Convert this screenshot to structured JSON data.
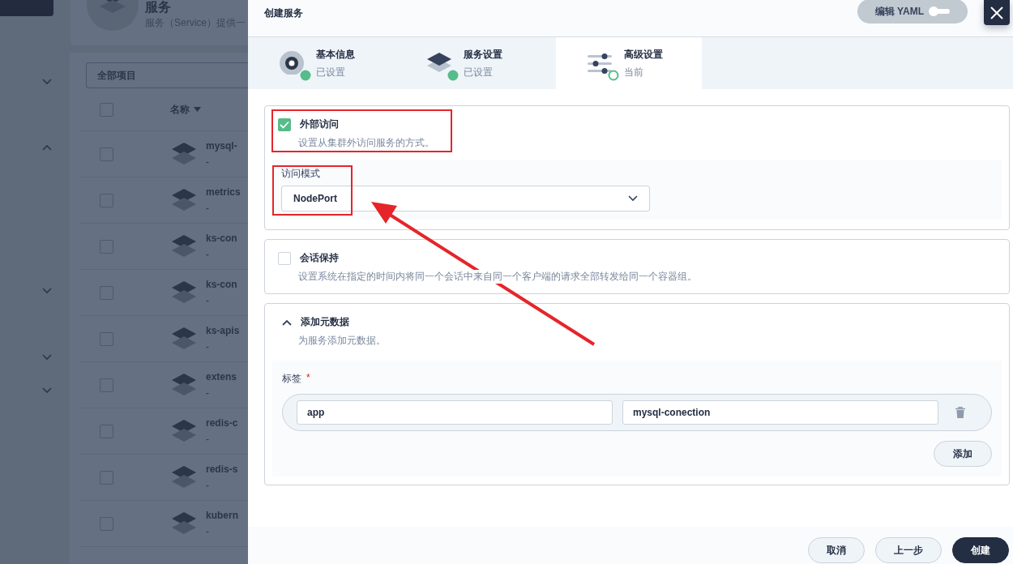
{
  "background_page": {
    "title": "服务",
    "subtitle": "服务（Service）提供一",
    "filter": "全部项目",
    "name_column": "名称",
    "header_checked": false,
    "sidebar_toggles": [
      {
        "expanded": false
      },
      {
        "expanded": true
      },
      {
        "expanded": false
      },
      {
        "expanded": false
      },
      {
        "expanded": false
      }
    ],
    "rows": [
      {
        "name": "mysql-",
        "detail": "-",
        "checked": false
      },
      {
        "name": "metrics",
        "detail": "-",
        "checked": false
      },
      {
        "name": "ks-con",
        "detail": "-",
        "checked": false
      },
      {
        "name": "ks-con",
        "detail": "-",
        "checked": false
      },
      {
        "name": "ks-apis",
        "detail": "-",
        "checked": false
      },
      {
        "name": "extens",
        "detail": "-",
        "checked": false
      },
      {
        "name": "redis-c",
        "detail": "-",
        "checked": false
      },
      {
        "name": "redis-s",
        "detail": "-",
        "checked": false
      },
      {
        "name": "kubern",
        "detail": "-",
        "checked": false
      }
    ]
  },
  "dialog": {
    "title": "创建服务",
    "yaml_toggle": {
      "label": "编辑 YAML",
      "on": false
    },
    "steps": [
      {
        "kind": "basic",
        "title": "基本信息",
        "status": "已设置",
        "completed": true,
        "selected": false
      },
      {
        "kind": "service",
        "title": "服务设置",
        "status": "已设置",
        "completed": true,
        "selected": false
      },
      {
        "kind": "advanced",
        "title": "高级设置",
        "status": "当前",
        "completed": false,
        "selected": true
      }
    ],
    "external_access": {
      "label": "外部访问",
      "description": "设置从集群外访问服务的方式。",
      "checked": true,
      "mode_label": "访问模式",
      "mode_value": "NodePort"
    },
    "session_affinity": {
      "label": "会话保持",
      "description": "设置系统在指定的时间内将同一个会话中来自同一个客户端的请求全部转发给同一个容器组。",
      "checked": false
    },
    "metadata": {
      "label": "添加元数据",
      "description": "为服务添加元数据。",
      "expanded": true,
      "labels_title": "标签",
      "required_mark": "*",
      "labels": [
        {
          "key": "app",
          "value": "mysql-conection"
        }
      ],
      "add_button": "添加"
    },
    "footer_buttons": [
      {
        "kind": "plain",
        "label": "取消"
      },
      {
        "kind": "plain",
        "label": "上一步"
      },
      {
        "kind": "primary",
        "label": "创建"
      }
    ]
  },
  "annotations": [
    {
      "kind": "box"
    },
    {
      "kind": "box"
    },
    {
      "kind": "arrow"
    }
  ]
}
